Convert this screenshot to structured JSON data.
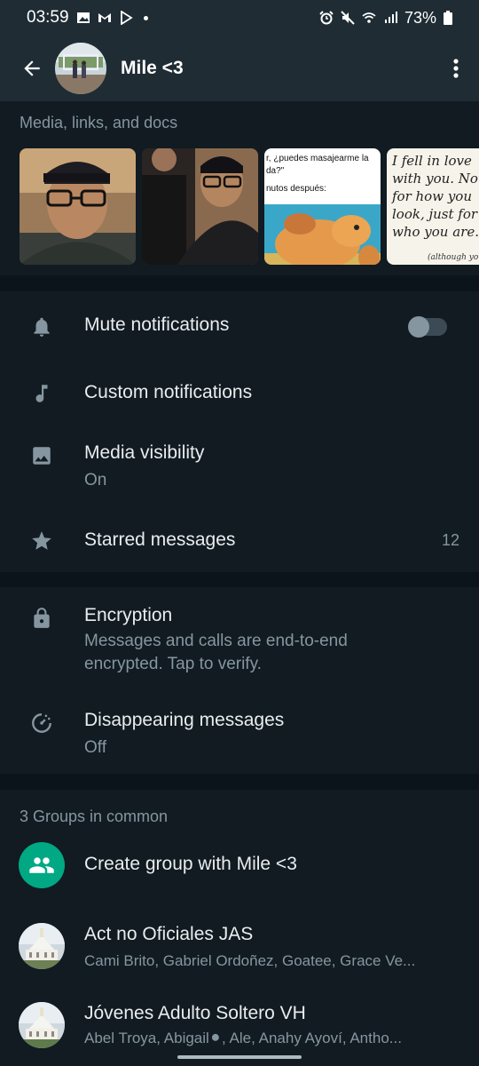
{
  "status_bar": {
    "time": "03:59",
    "left_icons": [
      "image-icon",
      "gmail-icon",
      "play-icon",
      "dot-icon"
    ],
    "right_icons": [
      "alarm-icon",
      "mute-icon",
      "wifi-icon",
      "signal-icon"
    ],
    "battery": "73%"
  },
  "header": {
    "title": "Mile <3"
  },
  "media": {
    "title": "Media, links, and docs",
    "thumb3_text_line1": "r, ¿puedes masajearme la",
    "thumb3_text_line2": "da?\"",
    "thumb3_text_line3": "nutos después:",
    "thumb4_text": "I fell in love with you. Not for how you look, just for who you are.",
    "thumb4_footer": "(although you"
  },
  "settings": {
    "mute_label": "Mute notifications",
    "mute_enabled": false,
    "custom_label": "Custom notifications",
    "media_visibility_label": "Media visibility",
    "media_visibility_value": "On",
    "starred_label": "Starred messages",
    "starred_count": "12"
  },
  "privacy": {
    "encryption_label": "Encryption",
    "encryption_sub_line1": "Messages and calls are end-to-end",
    "encryption_sub_line2": "encrypted. Tap to verify.",
    "disappearing_label": "Disappearing messages",
    "disappearing_value": "Off"
  },
  "groups": {
    "title": "3 Groups in common",
    "create_label": "Create group with Mile <3",
    "items": [
      {
        "name": "Act no Oficiales JAS",
        "members": "Cami Brito, Gabriel Ordoñez, Goatee, Grace Ve..."
      },
      {
        "name": "Jóvenes Adulto Soltero VH",
        "members": "Abel Troya, Abigail⚫, Ale, Anahy Ayoví, Antho..."
      }
    ]
  },
  "colors": {
    "background": "#0b141a",
    "panel": "#111b21",
    "header": "#1f2c34",
    "accent": "#00a884",
    "secondary_text": "#8696a0"
  }
}
